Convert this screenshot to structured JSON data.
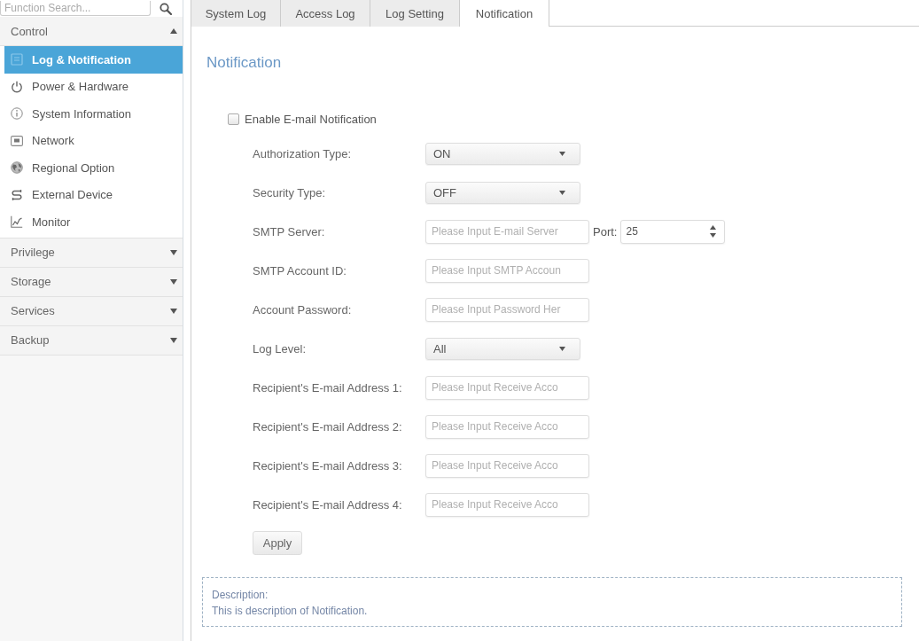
{
  "search": {
    "placeholder": "Function Search..."
  },
  "sidebar": {
    "groups": [
      {
        "label": "Control",
        "expanded": true,
        "items": [
          {
            "label": "Log & Notification",
            "selected": true
          },
          {
            "label": "Power & Hardware",
            "selected": false
          },
          {
            "label": "System Information",
            "selected": false
          },
          {
            "label": "Network",
            "selected": false
          },
          {
            "label": "Regional Option",
            "selected": false
          },
          {
            "label": "External Device",
            "selected": false
          },
          {
            "label": "Monitor",
            "selected": false
          }
        ]
      },
      {
        "label": "Privilege",
        "expanded": false
      },
      {
        "label": "Storage",
        "expanded": false
      },
      {
        "label": "Services",
        "expanded": false
      },
      {
        "label": "Backup",
        "expanded": false
      }
    ]
  },
  "tabs": [
    {
      "label": "System Log",
      "selected": false
    },
    {
      "label": "Access Log",
      "selected": false
    },
    {
      "label": "Log Setting",
      "selected": false
    },
    {
      "label": "Notification",
      "selected": true
    }
  ],
  "panel": {
    "title": "Notification",
    "enable": {
      "label": "Enable E-mail Notification",
      "checked": false
    },
    "fields": [
      {
        "kind": "select",
        "label": "Authorization Type:",
        "value": "ON"
      },
      {
        "kind": "select",
        "label": "Security Type:",
        "value": "OFF"
      },
      {
        "kind": "server",
        "label": "SMTP Server:",
        "placeholder": "Please Input E-mail Server",
        "port_label": "Port:",
        "port_value": "25"
      },
      {
        "kind": "text",
        "label": "SMTP Account ID:",
        "placeholder": "Please Input SMTP Accoun"
      },
      {
        "kind": "text",
        "label": "Account Password:",
        "placeholder": "Please Input Password Her"
      },
      {
        "kind": "select",
        "label": "Log Level:",
        "value": "All"
      },
      {
        "kind": "text",
        "label": "Recipient's E-mail Address 1:",
        "placeholder": "Please Input Receive Acco"
      },
      {
        "kind": "text",
        "label": "Recipient's E-mail Address 2:",
        "placeholder": "Please Input Receive Acco"
      },
      {
        "kind": "text",
        "label": "Recipient's E-mail Address 3:",
        "placeholder": "Please Input Receive Acco"
      },
      {
        "kind": "text",
        "label": "Recipient's E-mail Address 4:",
        "placeholder": "Please Input Receive Acco"
      }
    ],
    "apply": "Apply",
    "description": {
      "heading": "Description:",
      "text": "This is description of Notification."
    }
  }
}
